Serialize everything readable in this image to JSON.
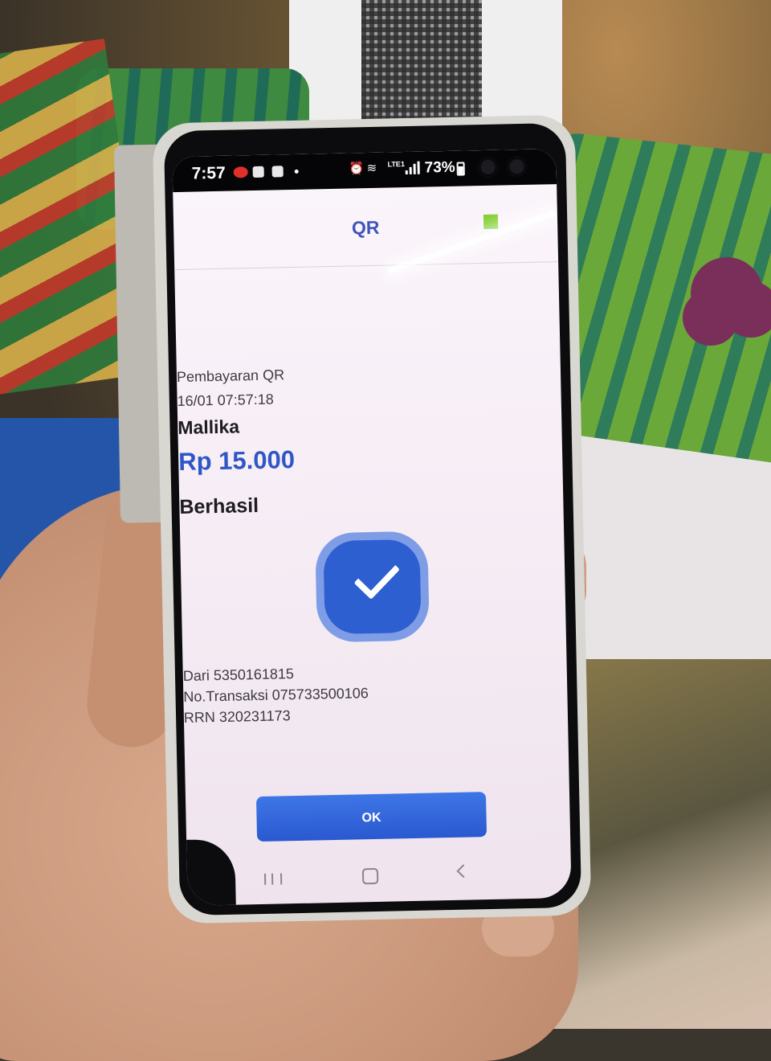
{
  "status_bar": {
    "time": "7:57",
    "battery": "73%",
    "network": "LTE1"
  },
  "app_header": {
    "title": "QR"
  },
  "transaction": {
    "type": "Pembayaran QR",
    "datetime": "16/01 07:57:18",
    "merchant": "Mallika",
    "amount": "Rp 15.000",
    "status": "Berhasil",
    "from": "Dari 5350161815",
    "transaction_no": "No.Transaksi 075733500106",
    "rrn": "RRN 320231173"
  },
  "actions": {
    "ok_label": "OK"
  },
  "colors": {
    "accent": "#2f56c6",
    "header_title": "#3f56b8",
    "button": "#2a58d0",
    "success_icon": "#2d5fd0"
  },
  "icons": {
    "status_check": "check-icon",
    "nav": [
      "recent-apps-icon",
      "home-icon",
      "back-icon"
    ]
  }
}
